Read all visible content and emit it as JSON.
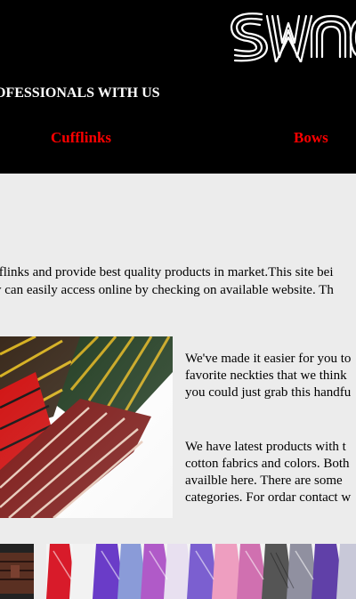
{
  "header": {
    "logo_text": "SWAG",
    "tagline": "OFESSIONALS WITH US",
    "nav": [
      {
        "label": "Cufflinks"
      },
      {
        "label": "Bows"
      }
    ]
  },
  "intro": {
    "line1": "fflinks and provide best quality products in market.This site bei",
    "line2": "y can easily access online by checking on available website. Th"
  },
  "about": {
    "para1": [
      "We've made it easier for you to",
      "favorite neckties that we think",
      "you could just grab this handfu"
    ],
    "para2": [
      "We have latest products with t",
      "cotton fabrics and colors. Both",
      "availble here. There are some",
      "categories. For ordar contact w"
    ]
  },
  "colors": {
    "header_bg": "#000000",
    "nav_link": "#ff0000",
    "page_bg": "#ececec"
  },
  "images": {
    "main": "striped-neckties-photo",
    "gallery_left": "tie-closeup-photo",
    "gallery_right": "row-of-ties-photo"
  }
}
